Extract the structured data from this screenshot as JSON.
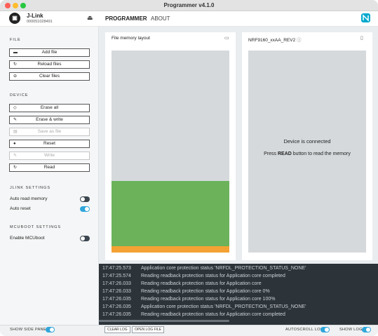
{
  "window": {
    "title": "Programmer v4.1.0"
  },
  "device": {
    "name": "J-Link",
    "serial": "000051028491",
    "icon": "chip-icon"
  },
  "nav": {
    "programmer": "PROGRAMMER",
    "about": "ABOUT"
  },
  "sidebar": {
    "file_heading": "FILE",
    "add_files": "Add file",
    "reload_files": "Reload files",
    "clear_files": "Clear files",
    "device_heading": "DEVICE",
    "erase_all": "Erase all",
    "erase_write": "Erase & write",
    "save_as_file": "Save as file",
    "reset": "Reset",
    "write": "Write",
    "read": "Read",
    "jlink_heading": "JLINK SETTINGS",
    "auto_read_memory": "Auto read memory",
    "auto_read_memory_on": false,
    "auto_reset": "Auto reset",
    "auto_reset_on": true,
    "mcuboot_heading": "MCUBOOT SETTINGS",
    "enable_mcuboot": "Enable MCUboot",
    "enable_mcuboot_on": false
  },
  "file_panel": {
    "title": "File memory layout"
  },
  "device_panel": {
    "title": "NRF9160_xxAA_REV2",
    "connected": "Device is connected",
    "hint_pre": "Press ",
    "hint_bold": "READ",
    "hint_post": " button to read the memory"
  },
  "log": [
    {
      "time": "17:47:25.573",
      "msg": "Application core protection status 'NRFDL_PROTECTION_STATUS_NONE'"
    },
    {
      "time": "17:47:25.574",
      "msg": "Reading readback protection status for Application core completed"
    },
    {
      "time": "17:47:26.033",
      "msg": "Reading readback protection status for Application core"
    },
    {
      "time": "17:47:26.033",
      "msg": "Reading readback protection status for Application core 0%"
    },
    {
      "time": "17:47:26.035",
      "msg": "Reading readback protection status for Application core 100%"
    },
    {
      "time": "17:47:26.035",
      "msg": "Application core protection status 'NRFDL_PROTECTION_STATUS_NONE'"
    },
    {
      "time": "17:47:26.035",
      "msg": "Reading readback protection status for Application core completed"
    }
  ],
  "footer": {
    "show_side_panel": "SHOW SIDE PANEL",
    "clear_log": "CLEAR LOG",
    "open_log_file": "OPEN LOG FILE",
    "autoscroll_log": "AUTOSCROLL LOG",
    "show_log": "SHOW LOG"
  },
  "colors": {
    "accent": "#2fa6da",
    "app_green": "#6bb25b",
    "app_orange": "#f4a233",
    "log_bg": "#2c3339"
  }
}
